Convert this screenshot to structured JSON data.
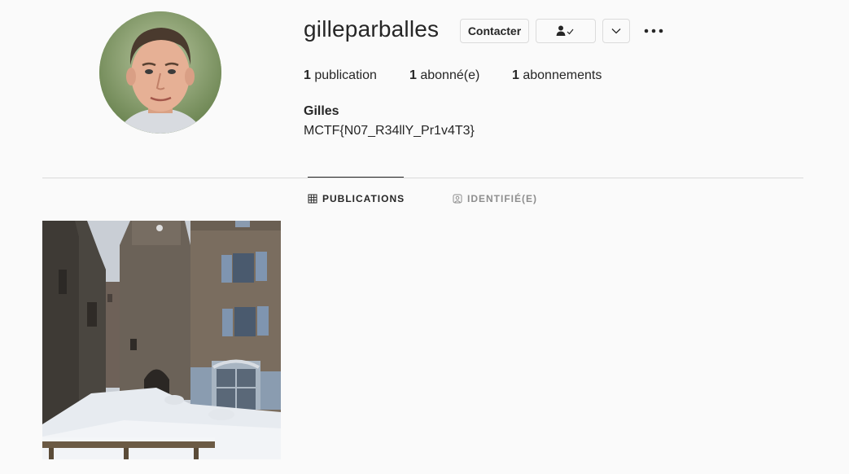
{
  "profile": {
    "username": "gilleparballes",
    "full_name": "Gilles",
    "bio": "MCTF{N07_R34llY_Pr1v4T3}"
  },
  "actions": {
    "contact_label": "Contacter",
    "following_icon": "person-check-icon",
    "suggestions_icon": "chevron-down-icon",
    "more_icon": "ellipsis-icon"
  },
  "stats": {
    "posts_count": "1",
    "posts_label": "publication",
    "followers_count": "1",
    "followers_label": "abonné(e)",
    "following_count": "1",
    "following_label": "abonnements"
  },
  "tabs": [
    {
      "label": "PUBLICATIONS",
      "icon": "grid-icon",
      "active": true
    },
    {
      "label": "IDENTIFIÉ(E)",
      "icon": "tagged-person-icon",
      "active": false
    }
  ],
  "posts": [
    {
      "subject": "snowy stone village street photo"
    }
  ],
  "colors": {
    "text": "#262626",
    "muted": "#8e8e8e",
    "border": "#dbdbdb",
    "background": "#fafafa"
  }
}
